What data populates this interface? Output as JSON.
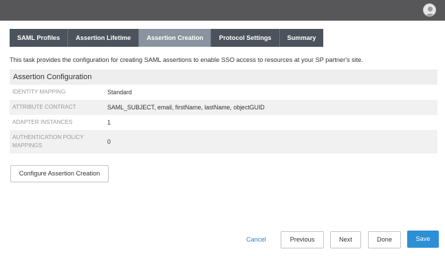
{
  "header": {
    "avatar_icon": "user-avatar-icon"
  },
  "tabs": [
    {
      "label": "SAML Profiles",
      "active": false
    },
    {
      "label": "Assertion Lifetime",
      "active": false
    },
    {
      "label": "Assertion Creation",
      "active": true
    },
    {
      "label": "Protocol Settings",
      "active": false
    },
    {
      "label": "Summary",
      "active": false
    }
  ],
  "intro_text": "This task provides the configuration for creating SAML assertions to enable SSO access to resources at your SP partner's site.",
  "config": {
    "title": "Assertion Configuration",
    "rows": [
      {
        "label": "IDENTITY MAPPING",
        "value": "Standard"
      },
      {
        "label": "ATTRIBUTE CONTRACT",
        "value": "SAML_SUBJECT, email, firstName, lastName, objectGUID"
      },
      {
        "label": "ADAPTER INSTANCES",
        "value": "1"
      },
      {
        "label": "AUTHENTICATION POLICY MAPPINGS",
        "value": "0"
      }
    ]
  },
  "buttons": {
    "configure": "Configure Assertion Creation",
    "cancel": "Cancel",
    "previous": "Previous",
    "next": "Next",
    "done": "Done",
    "save": "Save"
  },
  "colors": {
    "topbar": "#57575a",
    "tab": "#4c535c",
    "tab_active": "#8a949e",
    "accent": "#2d8fd5",
    "link": "#2a7fc1"
  }
}
